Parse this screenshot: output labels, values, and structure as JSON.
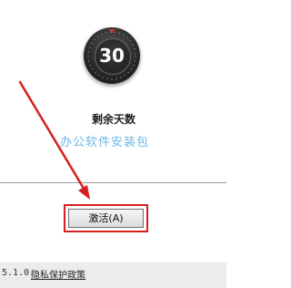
{
  "countdown": {
    "number": "30",
    "label": "剩余天数"
  },
  "watermark": "办公软件安装包",
  "buttons": {
    "activate": "激活(A)"
  },
  "footer": {
    "version": "5.1.0.",
    "privacy_link": "隐私保护政策"
  },
  "colors": {
    "highlight": "#d42020",
    "watermark": "#6bb7e6",
    "arrow": "#d42020"
  }
}
